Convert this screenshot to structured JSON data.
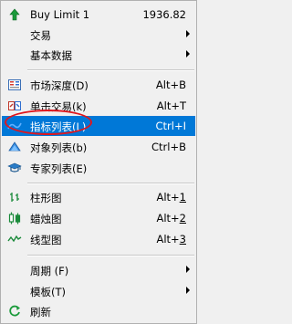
{
  "menu": {
    "items": [
      {
        "label": "Buy Limit 1",
        "shortcut": "1936.82",
        "icon": "green-up-arrow-icon"
      },
      {
        "label": "交易",
        "submenu": true
      },
      {
        "label": "基本数据",
        "submenu": true
      },
      {
        "label": "市场深度(D)",
        "shortcut": "Alt+B",
        "icon": "market-depth-icon"
      },
      {
        "label": "单击交易(k)",
        "shortcut": "Alt+T",
        "icon": "one-click-trading-icon"
      },
      {
        "label": "指标列表(L)",
        "shortcut": "Ctrl+I",
        "icon": "indicators-list-icon",
        "selected": true
      },
      {
        "label": "对象列表(b)",
        "shortcut": "Ctrl+B",
        "icon": "objects-list-icon"
      },
      {
        "label": "专家列表(E)",
        "icon": "experts-list-icon"
      },
      {
        "label": "柱形图",
        "shortcut_prefix": "Alt+",
        "shortcut_key": "1",
        "icon": "bar-chart-icon"
      },
      {
        "label": "蜡烛图",
        "shortcut_prefix": "Alt+",
        "shortcut_key": "2",
        "icon": "candlestick-icon"
      },
      {
        "label": "线型图",
        "shortcut_prefix": "Alt+",
        "shortcut_key": "3",
        "icon": "line-chart-icon"
      },
      {
        "label": "周期 (F)",
        "submenu": true
      },
      {
        "label": "模板(T)",
        "submenu": true
      },
      {
        "label": "刷新",
        "icon": "refresh-icon"
      }
    ]
  },
  "colors": {
    "highlight": "#0078d7",
    "annotation": "#e0161d"
  }
}
